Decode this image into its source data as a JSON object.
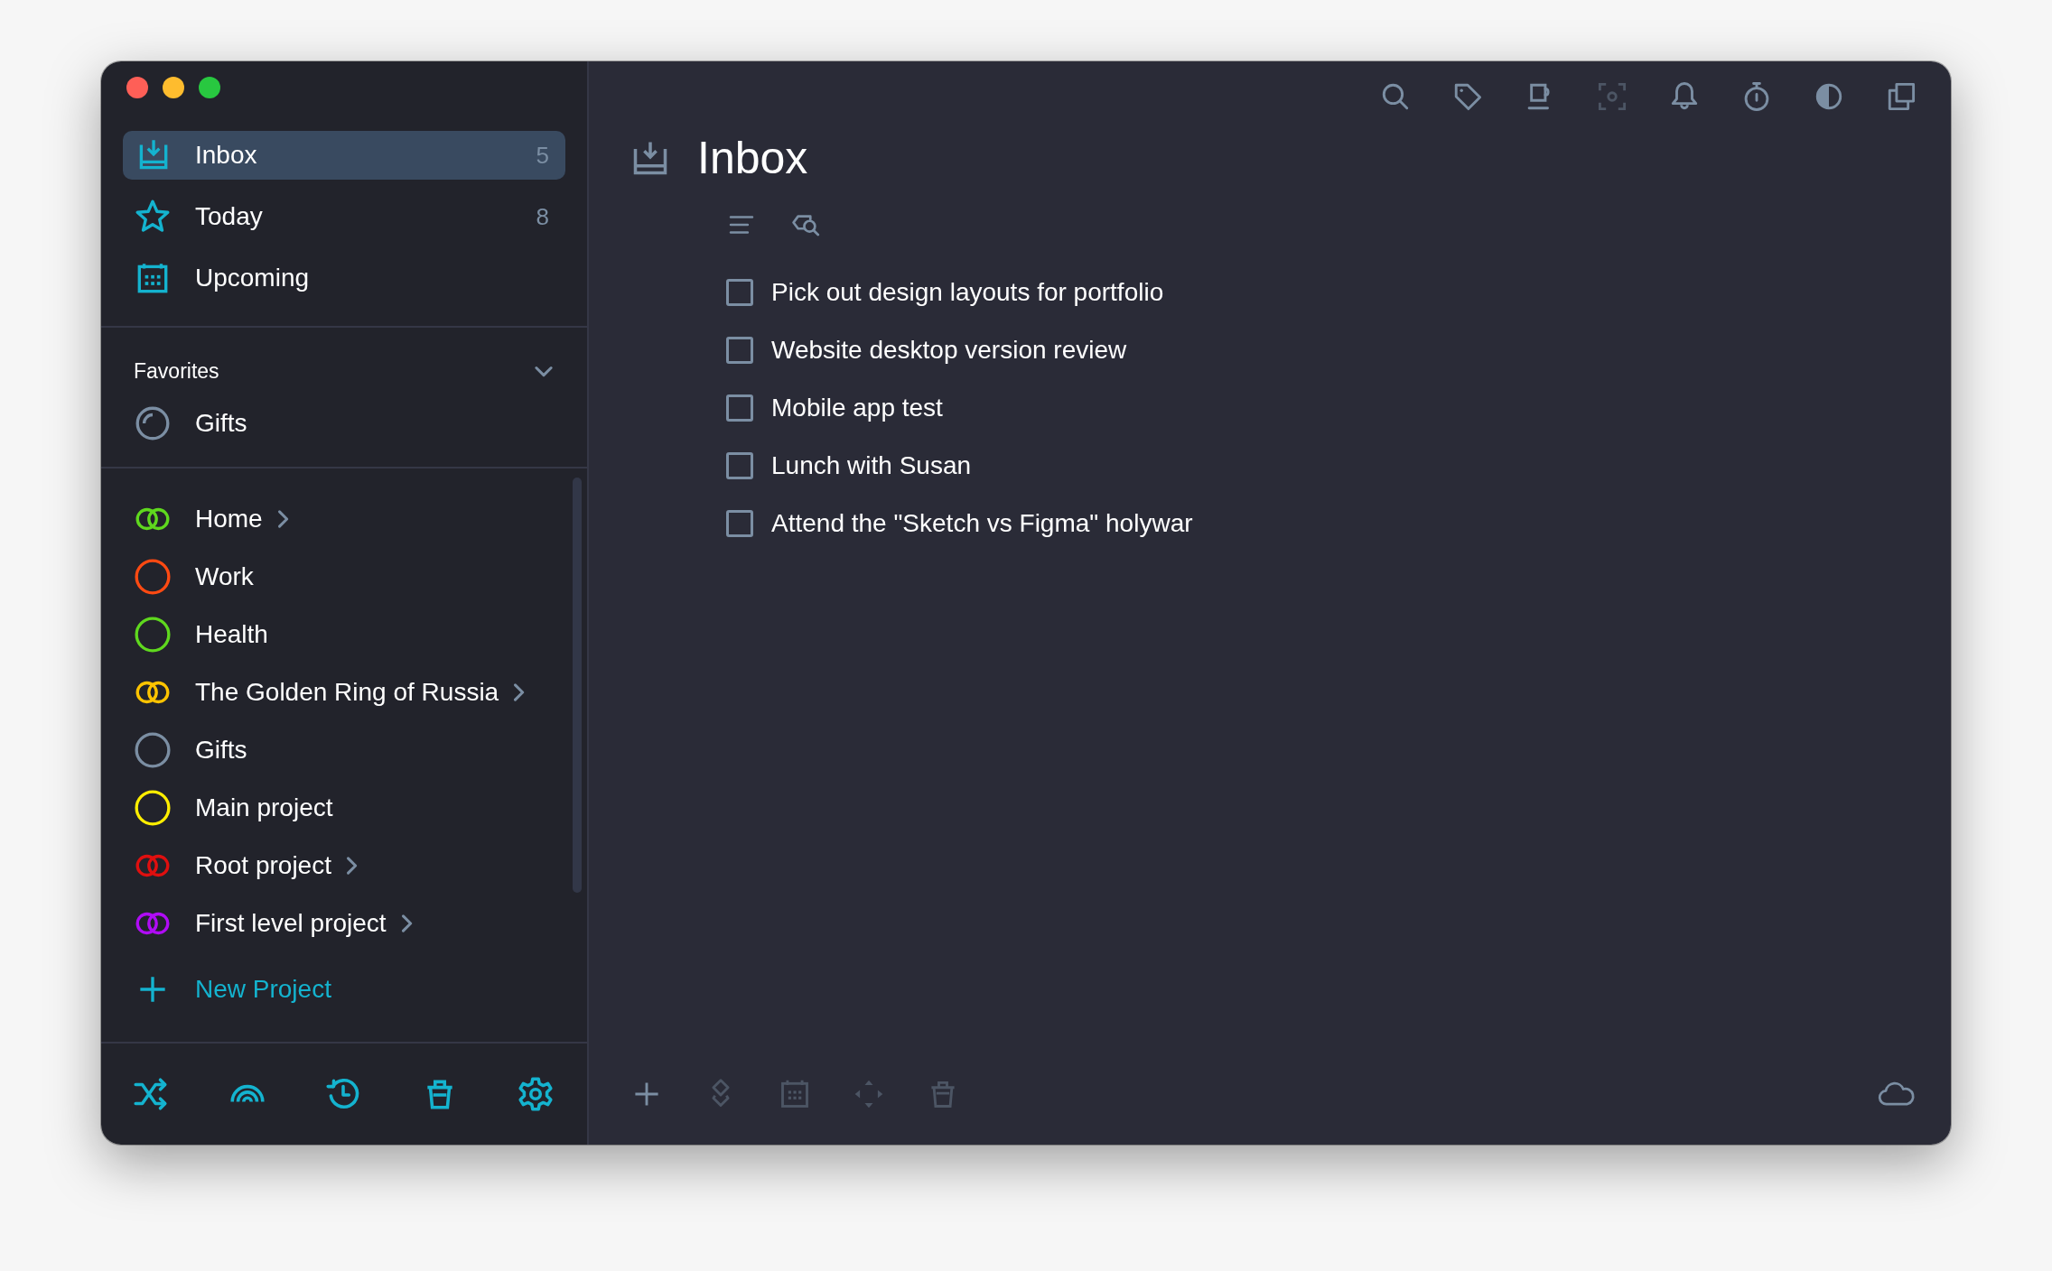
{
  "window": {
    "title": "Inbox"
  },
  "sidebar": {
    "nav": [
      {
        "label": "Inbox",
        "count": "5",
        "kind": "inbox",
        "selected": true
      },
      {
        "label": "Today",
        "count": "8",
        "kind": "today",
        "selected": false
      },
      {
        "label": "Upcoming",
        "kind": "upcoming",
        "selected": false
      }
    ],
    "favorites": {
      "title": "Favorites",
      "expanded": true,
      "items": [
        {
          "label": "Gifts",
          "kind": "progress",
          "color": "#7b8ea3"
        }
      ]
    },
    "projects": [
      {
        "label": "Home",
        "kind": "double",
        "color": "#5fd81e",
        "expandable": true
      },
      {
        "label": "Work",
        "kind": "single",
        "color": "#ff4a12",
        "expandable": false
      },
      {
        "label": "Health",
        "kind": "single",
        "color": "#5fd81e",
        "expandable": false
      },
      {
        "label": "The Golden Ring of Russia",
        "kind": "double",
        "color": "#ffc400",
        "expandable": true
      },
      {
        "label": "Gifts",
        "kind": "single",
        "color": "#7b8ea3",
        "expandable": false
      },
      {
        "label": "Main project",
        "kind": "single",
        "color": "#ffee00",
        "expandable": false
      },
      {
        "label": "Root project",
        "kind": "double",
        "color": "#e00f0f",
        "expandable": true
      },
      {
        "label": "First level project",
        "kind": "double",
        "color": "#b00cf5",
        "expandable": true
      }
    ],
    "new_project": "New Project"
  },
  "tasks": [
    {
      "title": "Pick out design layouts for portfolio",
      "checked": false
    },
    {
      "title": "Website desktop version review",
      "checked": false
    },
    {
      "title": "Mobile app test",
      "checked": false
    },
    {
      "title": "Lunch with Susan",
      "checked": false
    },
    {
      "title": "Attend the \"Sketch vs Figma\" holywar",
      "checked": false
    }
  ]
}
